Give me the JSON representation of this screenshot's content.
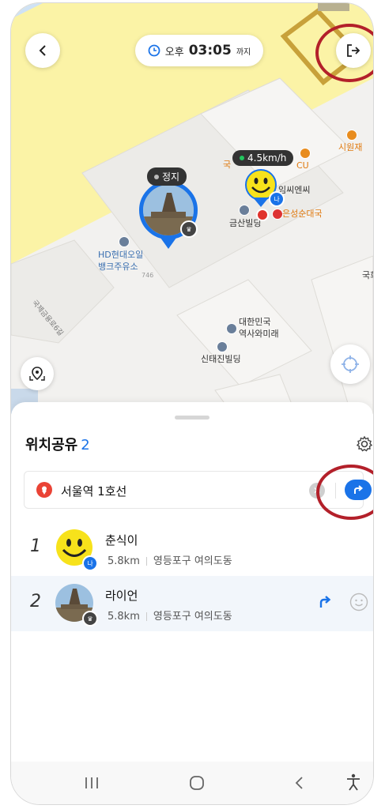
{
  "map": {
    "time_prefix": "오후",
    "time_value": "03:05",
    "time_suffix": "까지",
    "speed_tag": "4.5km/h",
    "stop_tag": "정지",
    "labels": {
      "siwonjae": "시원재",
      "cu": "CU",
      "gukmin": "국",
      "hyeonbanggungi": "임씨엔씨",
      "eunseong": "은성순대국",
      "geumsan": "금산빌딩",
      "hd_oil_1": "HD현대오일",
      "hd_oil_2": "뱅크주유소",
      "num_746": "746",
      "daehan_1": "대한민국",
      "daehan_2": "역사와미래",
      "sintae": "신태진빌딩",
      "road": "국제금융로6길",
      "right_edge": "국희"
    }
  },
  "sheet": {
    "title": "위치공유",
    "count": "2",
    "destination": "서울역 1호선",
    "members": [
      {
        "rank": "1",
        "name": "춘식이",
        "distance": "5.8km",
        "area": "영등포구 여의도동",
        "badge": "나"
      },
      {
        "rank": "2",
        "name": "라이언",
        "distance": "5.8km",
        "area": "영등포구 여의도동"
      }
    ]
  },
  "icons": {
    "back": "chevron-left-icon",
    "exit": "exit-icon",
    "clock": "clock-icon",
    "locate": "location-target-icon",
    "crosshair": "crosshair-icon",
    "settings": "gear-icon",
    "pin": "map-pin-icon",
    "share": "share-arrow-icon",
    "emoji": "smiley-icon"
  },
  "colors": {
    "accent": "#1a73e8",
    "highlight_circle": "#b3202a",
    "map_yellow": "#fbf3a6"
  }
}
